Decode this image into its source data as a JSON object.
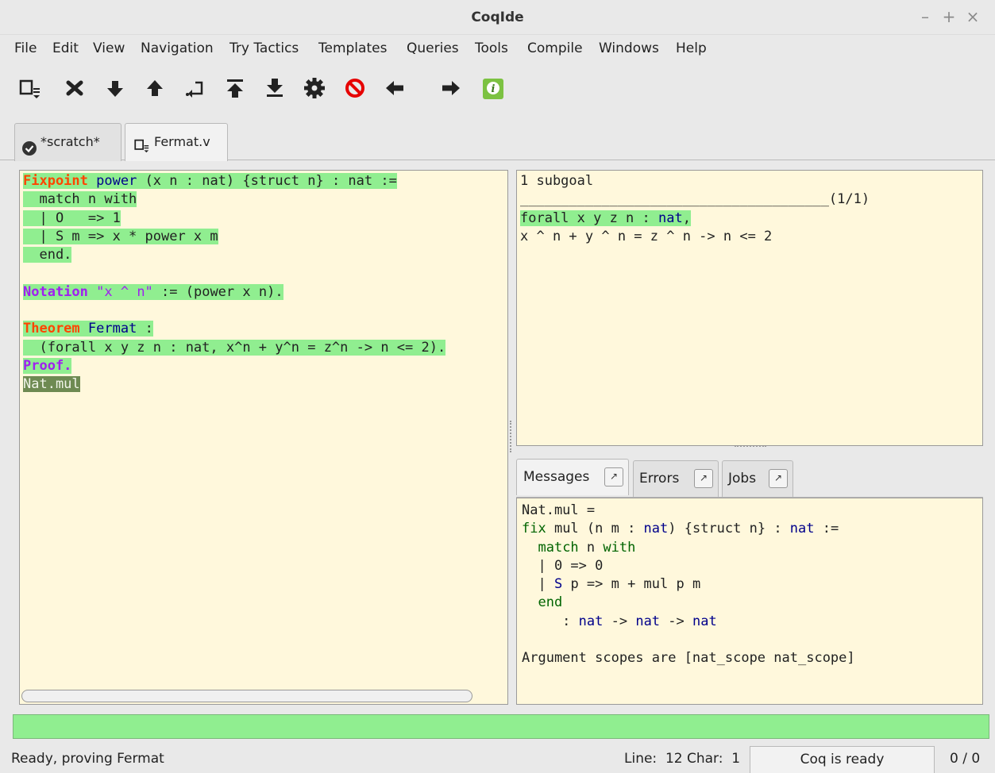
{
  "window": {
    "title": "CoqIde",
    "minimize": "–",
    "maximize": "+",
    "close": "×"
  },
  "menu": [
    "File",
    "Edit",
    "View",
    "Navigation",
    "Try Tactics",
    "Templates",
    "Queries",
    "Tools",
    "Compile",
    "Windows",
    "Help"
  ],
  "toolbar": [
    "save-icon",
    "close-icon",
    "forward-icon",
    "backward-icon",
    "goto-cursor-icon",
    "goto-start-icon",
    "goto-end-icon",
    "compile-gear-icon",
    "interrupt-icon",
    "previous-occurrence-icon",
    "next-occurrence-icon",
    "about-info-icon"
  ],
  "tabs": [
    {
      "label": "*scratch*",
      "icon": "check-circle-icon"
    },
    {
      "label": "Fermat.v",
      "icon": "save-icon"
    }
  ],
  "goals": {
    "count": "1 subgoal",
    "separator": "______________________________________(1/1)",
    "line1_a": "forall x y z n : ",
    "line1_b": "nat",
    "line1_c": ",",
    "line2": "x ^ n + y ^ n = z ^ n -> n <= 2"
  },
  "message_tabs": [
    {
      "label": "Messages"
    },
    {
      "label": "Errors"
    },
    {
      "label": "Jobs"
    }
  ],
  "messages": {
    "l1": "Nat.mul =",
    "l2_fix": "fix",
    "l2_a": " mul (n m : ",
    "l2_nat": "nat",
    "l2_b": ") {struct n} : ",
    "l2_nat2": "nat",
    "l2_c": " :=",
    "l3_indent": "  ",
    "l3_match": "match",
    "l3_b": " n ",
    "l3_with": "with",
    "l4": "  | 0 => 0",
    "l5_a": "  | ",
    "l5_S": "S",
    "l5_b": " p => m + mul p m",
    "l6_indent": "  ",
    "l6_end": "end",
    "l7_a": "     : ",
    "l7_nat1": "nat",
    "l7_b": " -> ",
    "l7_nat2": "nat",
    "l7_c": " -> ",
    "l7_nat3": "nat",
    "l8": "Argument scopes are [nat_scope nat_scope]"
  },
  "status": {
    "text": "Ready, proving Fermat",
    "line": "Line:  12 Char:  1",
    "coq": "Coq is ready",
    "count": "0 / 0"
  }
}
